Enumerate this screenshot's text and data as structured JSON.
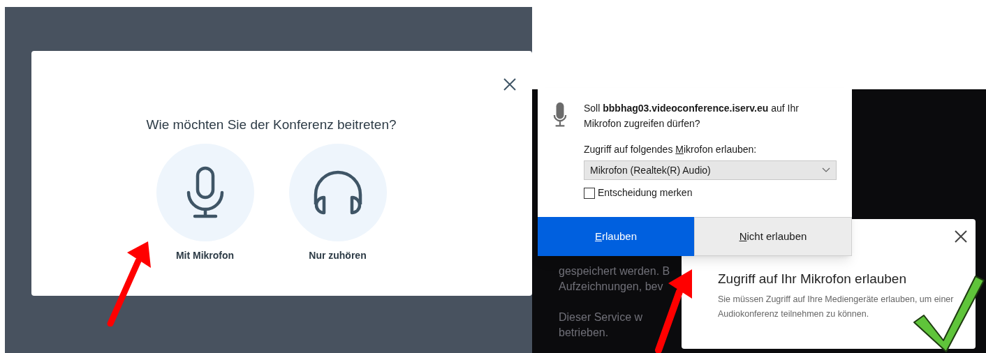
{
  "join_dialog": {
    "title": "Wie möchten Sie der Konferenz beitreten?",
    "options": [
      {
        "kind": "microphone",
        "label": "Mit Mikrofon"
      },
      {
        "kind": "listen",
        "label": "Nur zuhören"
      }
    ]
  },
  "background_text": [
    {
      "kind": "line",
      "text": "gespeichert werden. B"
    },
    {
      "kind": "line",
      "text": "Aufzeichnungen, bev"
    },
    {
      "kind": "paragraph_break"
    },
    {
      "kind": "line",
      "text": "Dieser Service w"
    },
    {
      "kind": "line",
      "text": "betrieben."
    }
  ],
  "permission_prompt": {
    "message": "Soll **bbbhag03.videoconference.iserv.eu** auf Ihr Mikrofon zugreifen dürfen?",
    "select_label": "Zugriff auf folgendes Mikrofon erlauben:",
    "select_value": "Mikrofon (Realtek(R) Audio)",
    "remember": {
      "label": "Entscheidung merken",
      "checked": false
    },
    "buttons": [
      {
        "kind": "primary",
        "label": "Erlauben"
      },
      {
        "kind": "secondary",
        "label": "Nicht erlauben"
      }
    ]
  },
  "toast": {
    "title": "Zugriff auf Ihr Mikrofon erlauben",
    "body": "Sie müssen Zugriff auf Ihre Mediengeräte erlauben, um einer Audiokonferenz teilnehmen zu können."
  }
}
